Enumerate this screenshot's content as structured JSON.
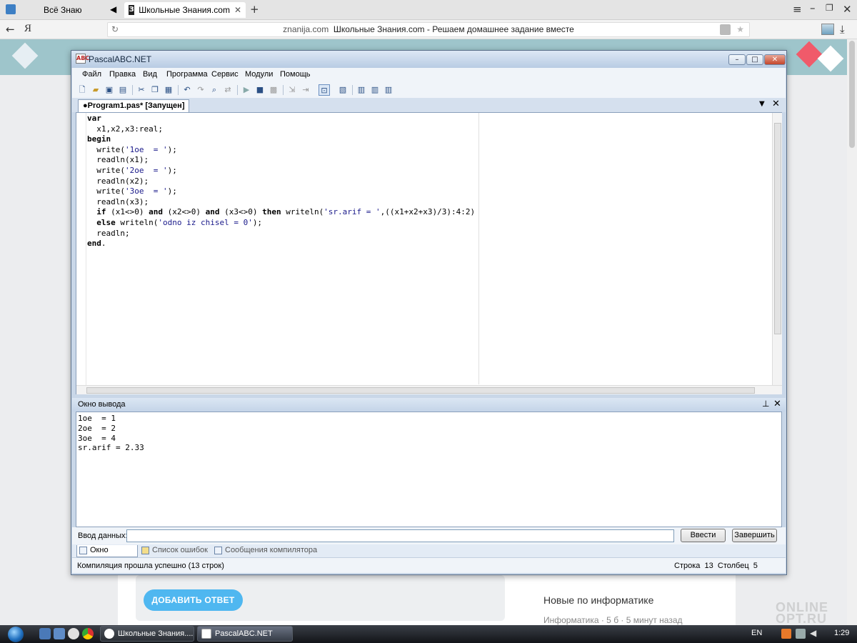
{
  "browser": {
    "tabs": [
      {
        "label": "Всё Знаю",
        "active": false
      },
      {
        "label": "Школьные Знания.com",
        "active": true
      }
    ],
    "address_domain": "znanija.com",
    "address_title": "Школьные Знания.com - Решаем домашнее задание вместе",
    "yandex_glyph": "Я"
  },
  "page": {
    "add_answer_label": "ДОБАВИТЬ ОТВЕТ",
    "sidebar_title": "Новые по информатике",
    "sidebar_meta": "Информатика · 5 б · 5 минут назад",
    "watermark_line1": "ONLINE",
    "watermark_line2": "OPT.RU"
  },
  "app": {
    "title": "PascalABC.NET",
    "menu": [
      "Файл",
      "Правка",
      "Вид",
      "Программа",
      "Сервис",
      "Модули",
      "Помощь"
    ],
    "document_tab": "●Program1.pas* [Запущен]",
    "code_lines": [
      "var",
      "  x1,x2,x3:real;",
      "begin",
      "  write('1oe  = ');",
      "  readln(x1);",
      "  write('2oe  = ');",
      "  readln(x2);",
      "  write('3oe  = ');",
      "  readln(x3);",
      "  if (x1<>0) and (x2<>0) and (x3<>0) then writeln('sr.arif = ',((x1+x2+x3)/3):4:2)",
      "  else writeln('odno iz chisel = 0');",
      "  readln;",
      "end."
    ],
    "output_title": "Окно вывода",
    "output_lines": [
      "1oe  = 1",
      "2oe  = 2",
      "3oe  = 4",
      "sr.arif = 2.33"
    ],
    "input_label": "Ввод данных:",
    "input_value": "",
    "enter_button": "Ввести",
    "stop_button": "Завершить",
    "bottom_tabs": [
      "Окно вывода",
      "Список ошибок",
      "Сообщения компилятора"
    ],
    "status": "Компиляция прошла успешно (13 строк)",
    "line_label": "Строка",
    "line_value": "13",
    "col_label": "Столбец",
    "col_value": "5"
  },
  "taskbar": {
    "tasks": [
      "Школьные Знания....",
      "PascalABC.NET"
    ],
    "lang": "EN",
    "time": "1:29"
  },
  "colors": {
    "accent": "#4fb7f0",
    "banner": "#9ec5cb",
    "window_frame": "#c9d7e8"
  }
}
